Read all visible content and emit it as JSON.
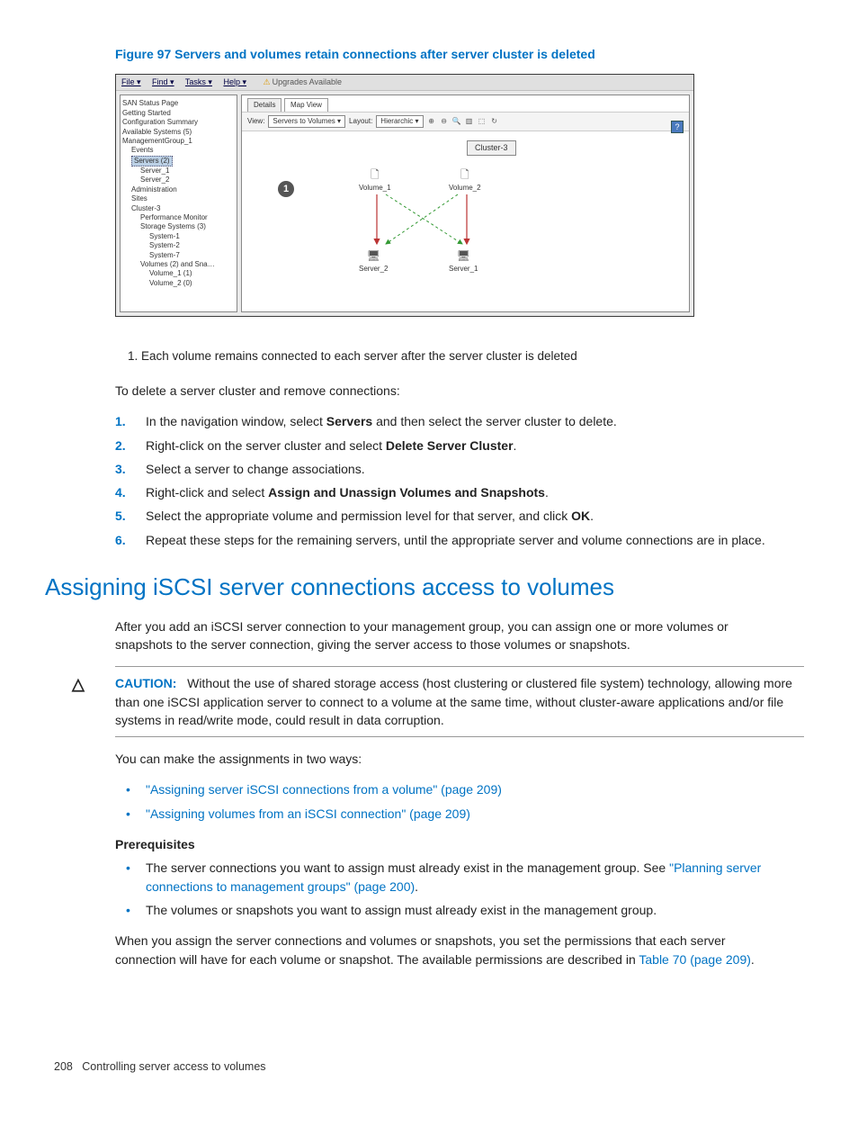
{
  "figure": {
    "label": "Figure 97 Servers and volumes retain connections after server cluster is deleted"
  },
  "screenshot": {
    "menu": {
      "file": "File ▾",
      "find": "Find ▾",
      "tasks": "Tasks ▾",
      "help": "Help ▾",
      "upgrades": "Upgrades Available"
    },
    "tree": {
      "n0": "SAN Status Page",
      "n1": "Getting Started",
      "n2": "Configuration Summary",
      "n3": "Available Systems (5)",
      "n4": "ManagementGroup_1",
      "n5": "Events",
      "n6": "Servers (2)",
      "n7": "Server_1",
      "n8": "Server_2",
      "n9": "Administration",
      "n10": "Sites",
      "n11": "Cluster-3",
      "n12": "Performance Monitor",
      "n13": "Storage Systems (3)",
      "n14": "System-1",
      "n15": "System-2",
      "n16": "System-7",
      "n17": "Volumes (2) and Sna…",
      "n18": "Volume_1 (1)",
      "n19": "Volume_2 (0)"
    },
    "tabs": {
      "details": "Details",
      "mapview": "Map View"
    },
    "toolbar": {
      "view_label": "View:",
      "view_value": "Servers to Volumes",
      "layout_label": "Layout:",
      "layout_value": "Hierarchic"
    },
    "diagram": {
      "cluster": "Cluster-3",
      "vol1": "Volume_1",
      "vol2": "Volume_2",
      "srv1": "Server_2",
      "srv2": "Server_1",
      "callout": "1"
    }
  },
  "callout_text": "1. Each volume remains connected to each server after the server cluster is deleted",
  "intro_para": "To delete a server cluster and remove connections:",
  "steps": {
    "s1a": "In the navigation window, select ",
    "s1b": "Servers",
    "s1c": " and then select the server cluster to delete.",
    "s2a": "Right-click on the server cluster and select ",
    "s2b": "Delete Server Cluster",
    "s2c": ".",
    "s3": "Select a server to change associations.",
    "s4a": "Right-click and select ",
    "s4b": "Assign and Unassign Volumes and Snapshots",
    "s4c": ".",
    "s5a": "Select the appropriate volume and permission level for that server, and click ",
    "s5b": "OK",
    "s5c": ".",
    "s6": "Repeat these steps for the remaining servers, until the appropriate server and volume connections are in place."
  },
  "section_heading": "Assigning iSCSI server connections access to volumes",
  "section_para": "After you add an iSCSI server connection to your management group, you can assign one or more volumes or snapshots to the server connection, giving the server access to those volumes or snapshots.",
  "caution": {
    "label": "CAUTION:",
    "text": "Without the use of shared storage access (host clustering or clustered file system) technology, allowing more than one iSCSI application server to connect to a volume at the same time, without cluster-aware applications and/or file systems in read/write mode, could result in data corruption."
  },
  "two_ways_intro": "You can make the assignments in two ways:",
  "way_links": {
    "l1": "\"Assigning server iSCSI connections from a volume\" (page 209)",
    "l2": "\"Assigning volumes from an iSCSI connection\" (page 209)"
  },
  "prereq_heading": "Prerequisites",
  "prereq": {
    "p1a": "The server connections you want to assign must already exist in the management group. See ",
    "p1b": "\"Planning server connections to management groups\" (page 200)",
    "p1c": ".",
    "p2": "The volumes or snapshots you want to assign must already exist in the management group."
  },
  "perm_para_a": "When you assign the server connections and volumes or snapshots, you set the permissions that each server connection will have for each volume or snapshot. The available permissions are described in ",
  "perm_para_link": "Table 70 (page 209)",
  "perm_para_b": ".",
  "footer": {
    "page": "208",
    "title": "Controlling server access to volumes"
  }
}
